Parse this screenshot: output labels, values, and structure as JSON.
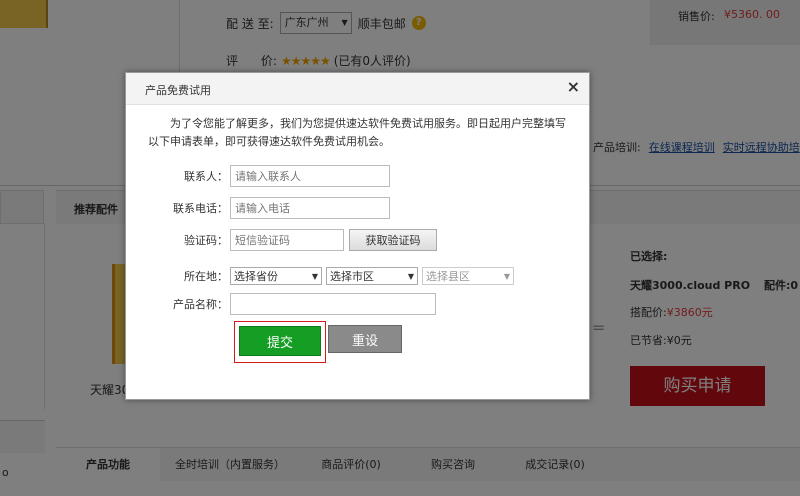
{
  "background": {
    "shipping_label": "配 送 至:",
    "shipping_region": "广东广州",
    "shipping_note": "顺丰包邮",
    "price_label": "销售价:",
    "price_value": "¥5360. 00",
    "rating_label": "评      价:",
    "rating_stars": "★★★★★",
    "rating_count": "(已有0人评价)",
    "training_label": "产品培训:",
    "training_links": [
      "在线课程培训",
      "实时远程协助培"
    ],
    "recommend_tab": "推荐配件",
    "recommend_product_name": "天耀30",
    "selected_title": "已选择:",
    "selected_product": "天耀3000.cloud PRO",
    "selected_parts": "配件:0",
    "bundle_price_label": "搭配价:",
    "bundle_price_value": "¥3860元",
    "saved": "已节省:¥0元",
    "buy_button": "购买申请",
    "lower_left_text": "o",
    "detail_tabs": [
      "产品功能",
      "全时培训（内置服务）",
      "商品评价(0)",
      "购买咨询",
      "成交记录(0)"
    ]
  },
  "modal": {
    "title": "产品免费试用",
    "close_glyph": "×",
    "intro": "为了令您能了解更多，我们为您提供速达软件免费试用服务。即日起用户完整填写以下申请表单，即可获得速达软件免费试用机会。",
    "fields": {
      "contact_label": "联系人：",
      "contact_placeholder": "请输入联系人",
      "phone_label": "联系电话：",
      "phone_placeholder": "请输入电话",
      "code_label": "验证码：",
      "code_placeholder": "短信验证码",
      "get_code_button": "获取验证码",
      "location_label": "所在地：",
      "province": "选择省份",
      "city": "选择市区",
      "district": "选择县区",
      "product_label": "产品名称："
    },
    "submit": "提交",
    "reset": "重设"
  },
  "colors": {
    "submit_green": "#149e23",
    "buy_red": "#c4111a",
    "price_red": "#e4393c",
    "link_blue": "#1a4ea0"
  }
}
